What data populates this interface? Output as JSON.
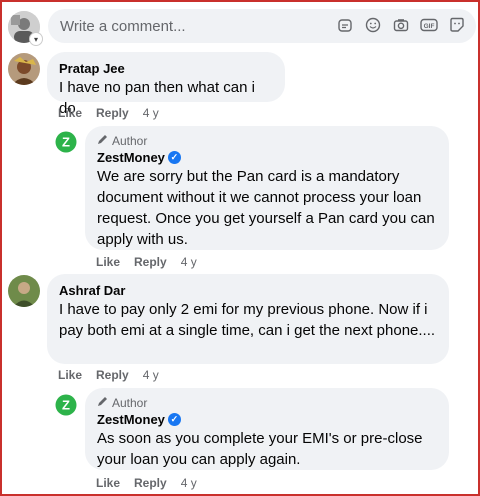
{
  "composer": {
    "placeholder": "Write a comment...",
    "icons": [
      "sticker-icon",
      "emoji-icon",
      "camera-icon",
      "gif-icon",
      "sticker-face-icon"
    ],
    "gif_label": "GIF"
  },
  "comments": [
    {
      "author": "Pratap Jee",
      "text": "I have no pan then what can i do",
      "like": "Like",
      "reply": "Reply",
      "time": "4 y",
      "reply_thread": {
        "tag": "Author",
        "author": "ZestMoney",
        "text": "We are sorry but the Pan card is a mandatory document without it we cannot process your loan request. Once you get yourself a Pan card you can apply with us.",
        "like": "Like",
        "reply": "Reply",
        "time": "4 y"
      }
    },
    {
      "author": "Ashraf Dar",
      "text": "I have to pay only 2 emi for my previous phone. Now if i pay both emi at a single time, can i get the next phone....",
      "like": "Like",
      "reply": "Reply",
      "time": "4 y",
      "reply_thread": {
        "tag": "Author",
        "author": "ZestMoney",
        "text": "As soon as you complete your EMI's or pre-close your loan you can apply again.",
        "like": "Like",
        "reply": "Reply",
        "time": "4 y"
      }
    }
  ],
  "colors": {
    "bubble": "#f0f2f5",
    "brand_green": "#2db34a",
    "verified_blue": "#1877f2"
  }
}
